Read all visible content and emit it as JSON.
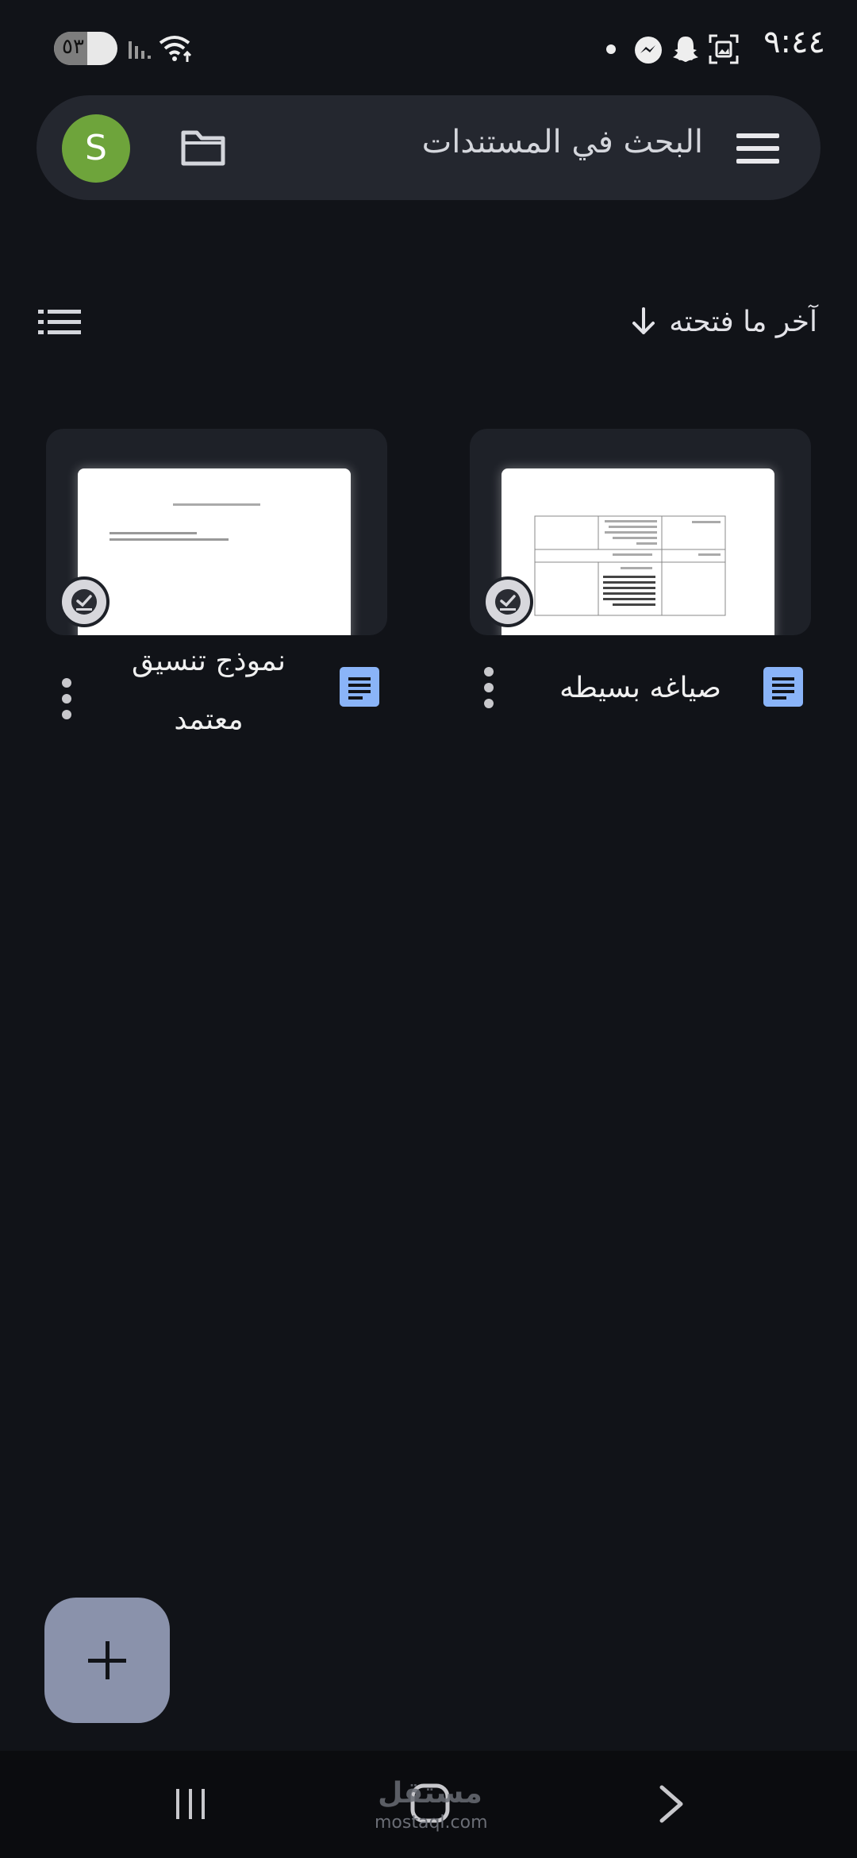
{
  "status_bar": {
    "time": "٩:٤٤",
    "battery_text": "٥٣",
    "battery_level": 0.53
  },
  "search_bar": {
    "placeholder": "البحث في المستندات",
    "avatar_letter": "S",
    "avatar_color": "#6ea43b"
  },
  "sort": {
    "label": "آخر ما فتحته"
  },
  "documents": [
    {
      "title_line1": "صياغه بسيطه",
      "title_line2": ""
    },
    {
      "title_line1": "نموذج تنسيق",
      "title_line2": "معتمد"
    }
  ],
  "nav": {
    "watermark": "مستقل",
    "watermark_sub": "mostaql.com"
  },
  "colors": {
    "background": "#111318",
    "doc_icon": "#8ab4f8",
    "fab": "#8a92ab"
  }
}
